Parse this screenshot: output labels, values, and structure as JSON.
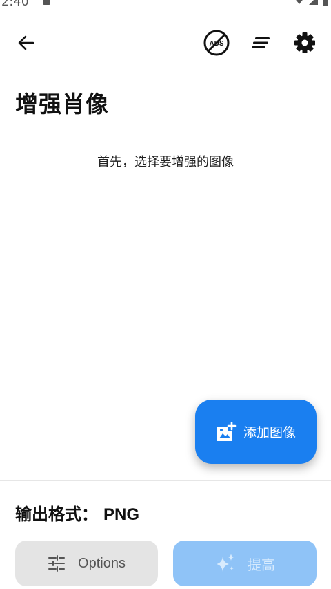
{
  "status_bar": {
    "time": "2:40"
  },
  "app_bar": {
    "back_icon": "arrow-back-icon",
    "ads_icon": "remove-ads-icon",
    "ads_text": "ADS",
    "sort_icon": "sort-icon",
    "settings_icon": "gear-icon"
  },
  "page": {
    "title": "增强肖像",
    "hint": "首先，选择要增强的图像"
  },
  "fab": {
    "label": "添加图像",
    "icon": "add-photo-icon"
  },
  "bottom": {
    "format_label": "输出格式：",
    "format_value": "PNG",
    "options_label": "Options",
    "options_icon": "tune-icon",
    "enhance_label": "提高",
    "enhance_icon": "sparkle-icon"
  },
  "colors": {
    "accent": "#1a7ff0",
    "accent_disabled": "#8fc3f7",
    "options_bg": "#e4e4e4",
    "text": "#111111"
  }
}
